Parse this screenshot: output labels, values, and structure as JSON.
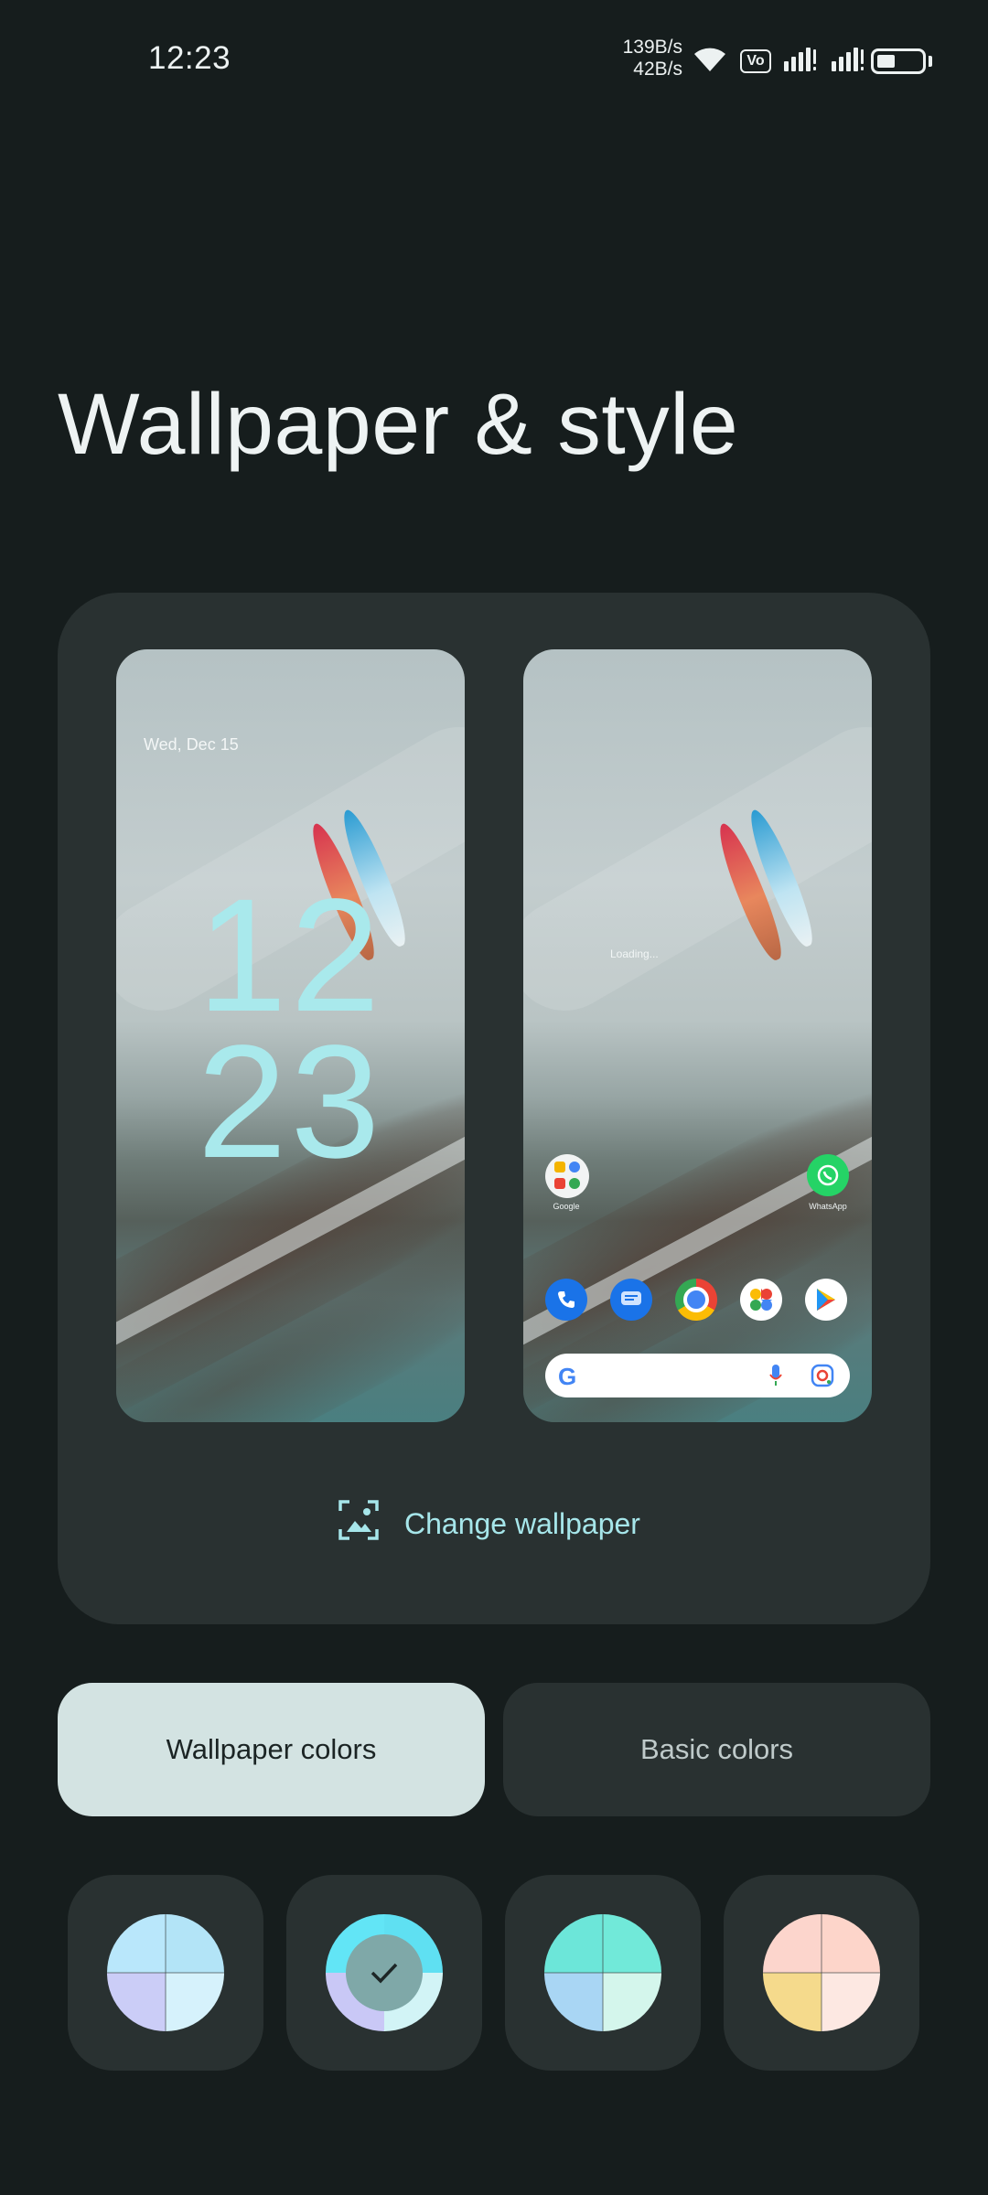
{
  "status_bar": {
    "time": "12:23",
    "net_up": "139B/s",
    "net_down": "42B/s",
    "volte_label": "Vo",
    "icons": [
      "wifi-icon",
      "volte-icon",
      "signal-icon",
      "signal-icon",
      "battery-icon"
    ],
    "battery_level": 0.4
  },
  "page": {
    "title": "Wallpaper & style"
  },
  "preview": {
    "lock_screen": {
      "date": "Wed, Dec 15",
      "clock_hours": "12",
      "clock_minutes": "23"
    },
    "home_screen": {
      "loading_text": "Loading...",
      "folder_label": "Google",
      "whatsapp_label": "WhatsApp",
      "dock_apps": [
        "phone-icon",
        "messages-icon",
        "chrome-icon",
        "photos-icon",
        "play-store-icon"
      ],
      "search_bar_icons": [
        "google-g-icon",
        "mic-icon",
        "lens-icon"
      ]
    },
    "change_wallpaper_label": "Change wallpaper"
  },
  "tabs": [
    {
      "label": "Wallpaper colors",
      "selected": true
    },
    {
      "label": "Basic colors",
      "selected": false
    }
  ],
  "swatches": [
    {
      "colors": [
        "#b9e7fb",
        "#b3e4f7",
        "#cbcdf7",
        "#d6f2fc"
      ],
      "selected": false
    },
    {
      "colors": [
        "#62e5f6",
        "#5fe0f2",
        "#c9c8f6",
        "#d2f4f6"
      ],
      "selected": true
    },
    {
      "colors": [
        "#6ce6d9",
        "#71e9d9",
        "#a9d6f4",
        "#d4f6ec"
      ],
      "selected": false
    },
    {
      "colors": [
        "#fcd5cc",
        "#fdd5ca",
        "#f5da8c",
        "#fde8e2"
      ],
      "selected": false
    }
  ],
  "colors": {
    "background": "#161d1d",
    "card": "#293131",
    "accent": "#a6e6ea",
    "selected_tab": "#d3e3e2"
  }
}
